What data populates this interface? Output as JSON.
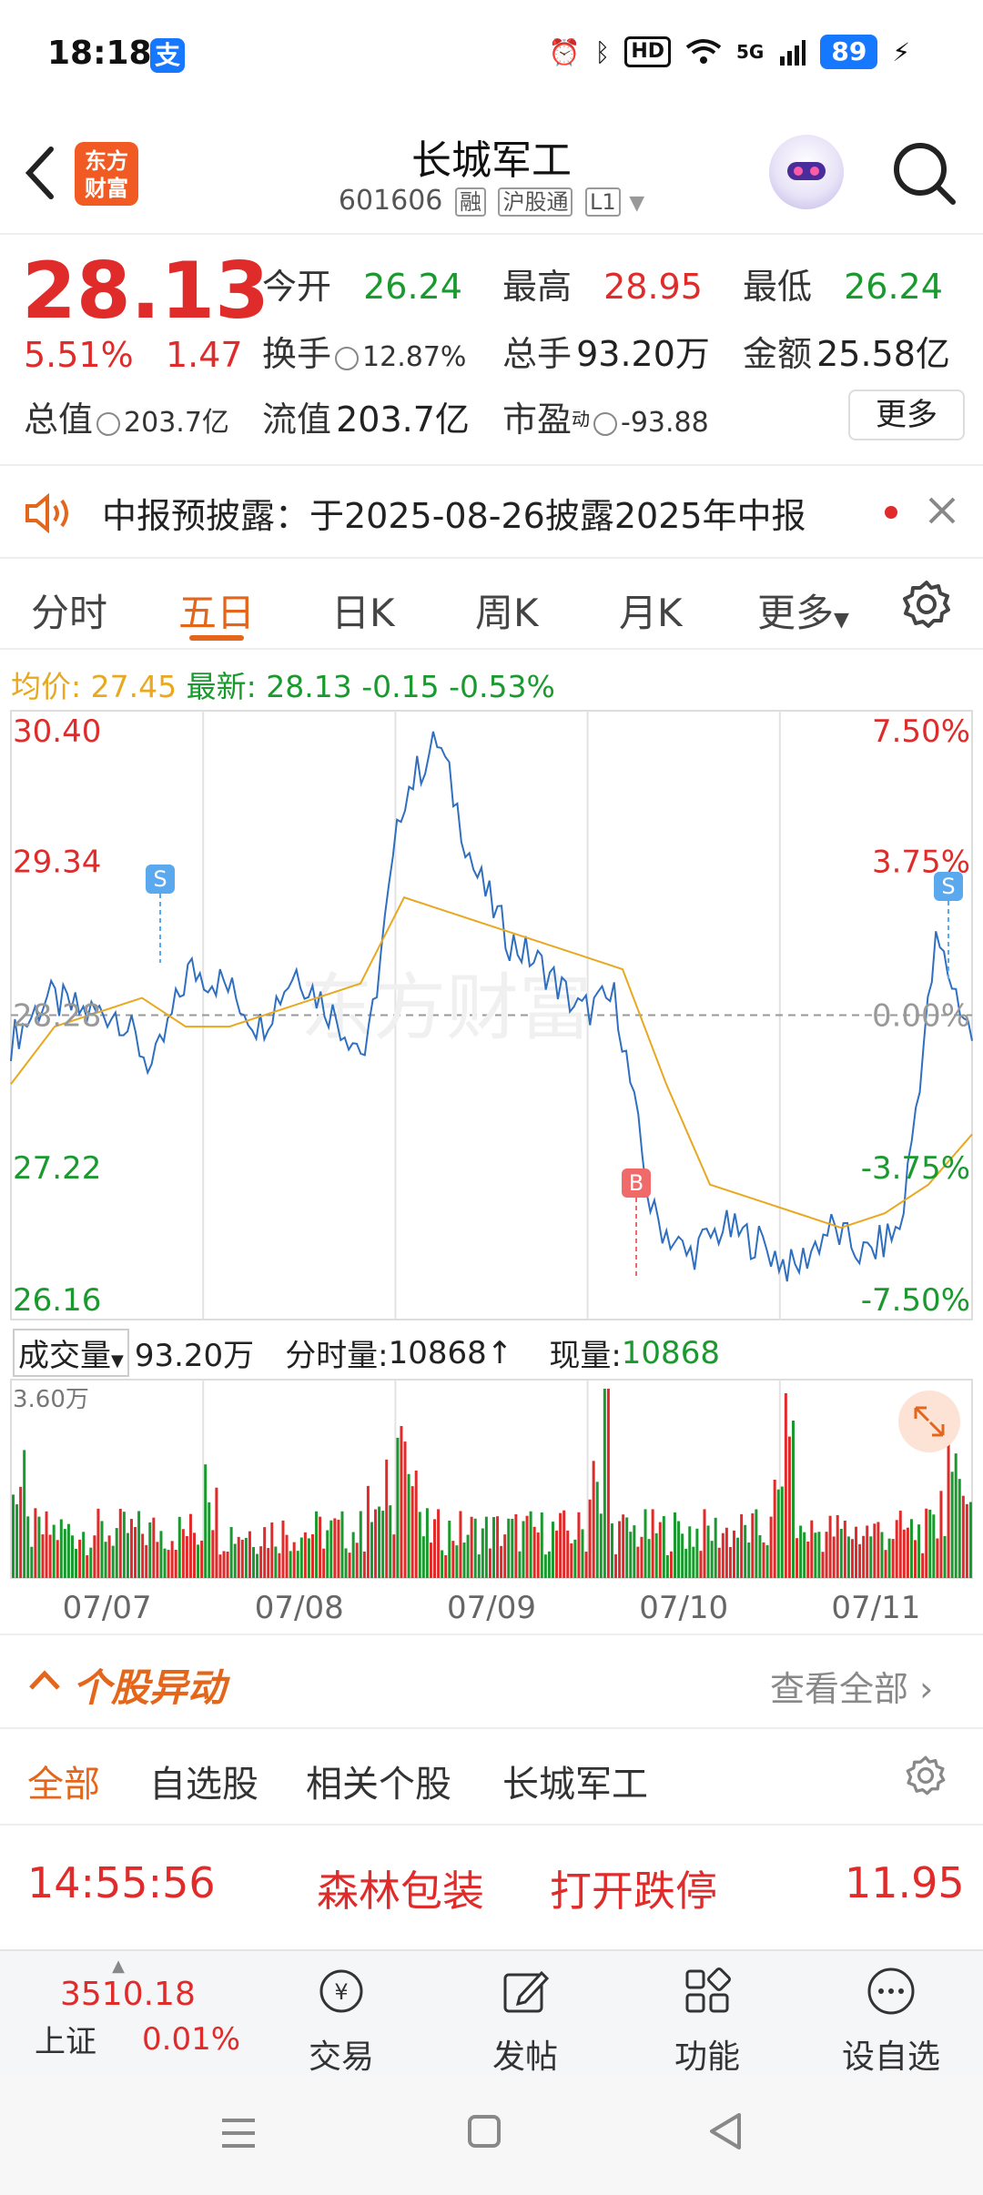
{
  "status_bar": {
    "time": "18:18",
    "app_badge": "支",
    "hd": "HD",
    "signal": "5G",
    "battery": "89"
  },
  "header": {
    "logo": "东方\n财富",
    "stock_name": "长城军工",
    "stock_code": "601606",
    "tags": [
      "融",
      "沪股通",
      "L1"
    ]
  },
  "quote": {
    "price": "28.13",
    "change_pct": "5.51%",
    "change_amt": "1.47",
    "open_label": "今开",
    "open": "26.24",
    "high_label": "最高",
    "high": "28.95",
    "low_label": "最低",
    "low": "26.24",
    "turnover_label": "换手",
    "turnover": "12.87%",
    "vol_label": "总手",
    "vol": "93.20万",
    "amount_label": "金额",
    "amount": "25.58亿",
    "mktcap_label": "总值",
    "mktcap": "203.7亿",
    "float_label": "流值",
    "float": "203.7亿",
    "pe_label": "市盈",
    "pe_sup": "动",
    "pe": "-93.88",
    "more": "更多"
  },
  "notice": {
    "text": "中报预披露：于2025-08-26披露2025年中报"
  },
  "tabs": [
    "分时",
    "五日",
    "日K",
    "周K",
    "月K",
    "更多"
  ],
  "active_tab": "五日",
  "avg_line": {
    "avg_label": "均价:",
    "avg": "27.45",
    "latest_label": "最新:",
    "latest": "28.13",
    "chg": "-0.15",
    "pct": "-0.53%"
  },
  "chart_data": {
    "type": "line",
    "x_labels": [
      "07/07",
      "07/08",
      "07/09",
      "07/10",
      "07/11"
    ],
    "y_left": [
      "30.40",
      "29.34",
      "28.28",
      "27.22",
      "26.16"
    ],
    "y_right": [
      "7.50%",
      "3.75%",
      "0.00%",
      "-3.75%",
      "-7.50%"
    ],
    "ylim": [
      26.16,
      30.4
    ],
    "series": [
      {
        "values": [
          28.1,
          28.4,
          28.3,
          28.3,
          27.9,
          28.6,
          28.5,
          28.2,
          28.6,
          28.3,
          28.0,
          29.8,
          30.2,
          29.3,
          28.8,
          28.6,
          28.3,
          28.4,
          26.9,
          26.6,
          26.8,
          26.7,
          26.5,
          26.8,
          26.6,
          26.8,
          28.8,
          28.13
        ]
      },
      {
        "values": [
          27.8,
          28.2,
          28.3,
          28.4,
          28.2,
          28.2,
          28.3,
          28.4,
          28.5,
          29.1,
          29.0,
          28.9,
          28.8,
          28.7,
          28.6,
          27.8,
          27.1,
          27.0,
          26.9,
          26.8,
          26.9,
          27.1,
          27.45
        ]
      }
    ],
    "volume_max": "3.60万"
  },
  "volume_head": {
    "label": "成交量",
    "total": "93.20万",
    "tick_label": "分时量:",
    "tick": "10868",
    "now_label": "现量:",
    "now": "10868"
  },
  "anomaly": {
    "title": "个股异动",
    "view_all": "查看全部",
    "filters": [
      "全部",
      "自选股",
      "相关个股",
      "长城军工"
    ]
  },
  "event": {
    "time": "14:55:56",
    "name": "森林包装",
    "type": "打开跌停",
    "price": "11.95"
  },
  "bottom_nav": {
    "index_value": "3510.18",
    "index_name": "上证",
    "index_pct": "0.01%",
    "items": [
      "交易",
      "发帖",
      "功能",
      "设自选"
    ]
  },
  "colors": {
    "up": "#e02b2b",
    "down": "#1a9a2e",
    "accent": "#e4661b",
    "avg_line": "#e8a820"
  }
}
